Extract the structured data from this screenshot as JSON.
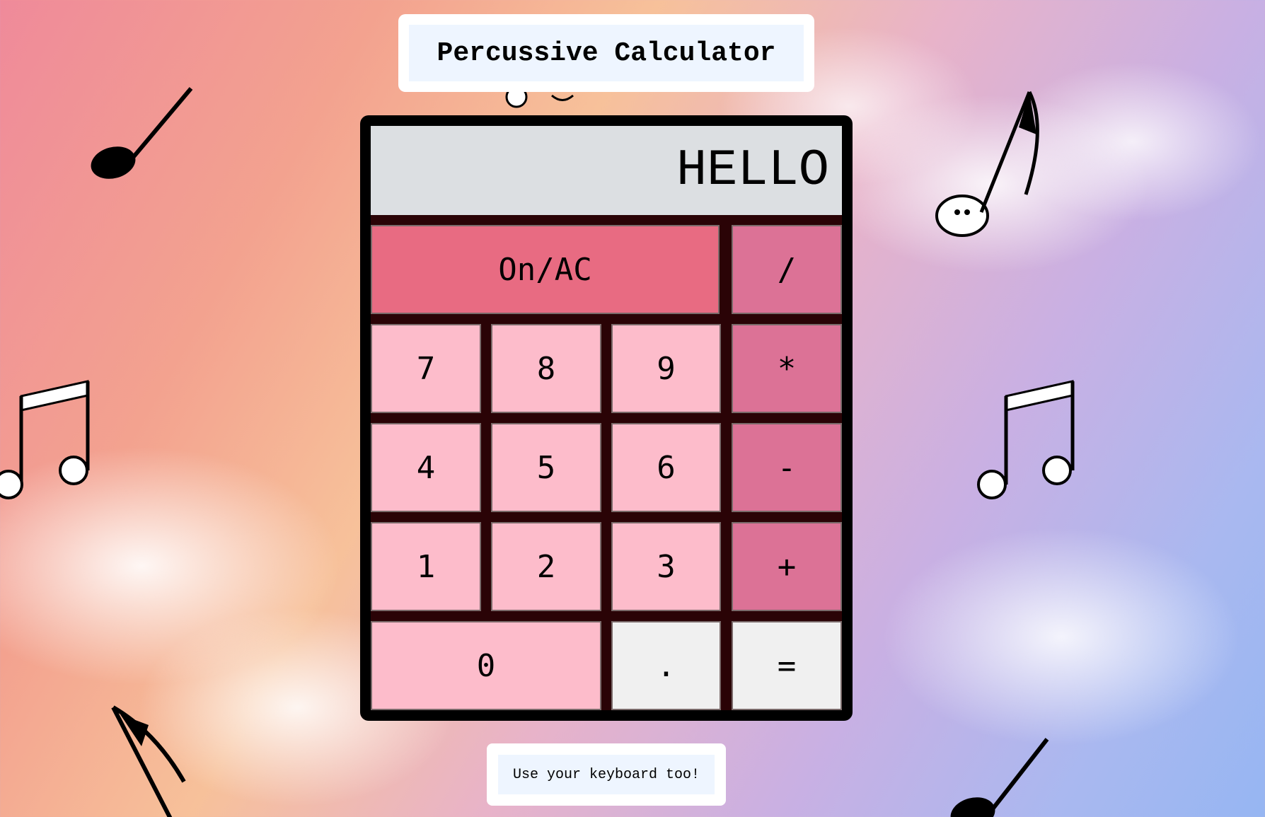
{
  "header": {
    "title": "Percussive Calculator"
  },
  "display": {
    "value": "HELLO"
  },
  "keys": {
    "clear": "On/AC",
    "divide": "/",
    "seven": "7",
    "eight": "8",
    "nine": "9",
    "multiply": "*",
    "four": "4",
    "five": "5",
    "six": "6",
    "subtract": "-",
    "one": "1",
    "two": "2",
    "three": "3",
    "add": "+",
    "zero": "0",
    "decimal": ".",
    "equals": "="
  },
  "footer": {
    "hint": "Use your keyboard too!"
  },
  "colors": {
    "number_key": "#fdbccb",
    "operator_key": "#dc7296",
    "clear_key": "#e86b82",
    "light_key": "#f0f0f0",
    "display_bg": "#dcdfe2",
    "frame": "#000000"
  },
  "decorations": [
    "quarter-note-icon",
    "beamed-eighth-notes-icon",
    "eighth-note-face-icon",
    "eighth-note-icon"
  ]
}
